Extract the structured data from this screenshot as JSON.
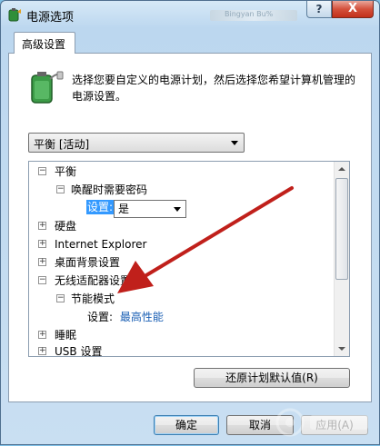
{
  "window": {
    "title": "电源选项",
    "title_blur": "Bingyan Bu%"
  },
  "titlebar_buttons": {
    "help": "?",
    "close": "X"
  },
  "tab": {
    "label": "高级设置"
  },
  "description": "选择您要自定义的电源计划，然后选择您希望计算机管理的电源设置。",
  "plan_select": {
    "value": "平衡 [活动]"
  },
  "tree": {
    "items": [
      {
        "label": "平衡",
        "expander": "−"
      },
      {
        "label": "唤醒时需要密码",
        "expander": "−"
      },
      {
        "label": "硬盘",
        "expander": "+"
      },
      {
        "label": "Internet Explorer",
        "expander": "+"
      },
      {
        "label": "桌面背景设置",
        "expander": "+"
      },
      {
        "label": "无线适配器设置",
        "expander": "−"
      },
      {
        "label": "节能模式",
        "expander": "−"
      },
      {
        "label": "睡眠",
        "expander": "+"
      },
      {
        "label": "USB 设置",
        "expander": "+"
      }
    ],
    "wake_setting": {
      "label": "设置:",
      "value": "是"
    },
    "power_saving_setting": {
      "label": "设置:",
      "value": "最高性能"
    }
  },
  "buttons": {
    "restore": "还原计划默认值(R)",
    "ok": "确定",
    "cancel": "取消",
    "apply": "应用(A)"
  },
  "colors": {
    "accent_red": "#c0201b",
    "link_blue": "#1a5fb4",
    "selection": "#3399ff"
  }
}
